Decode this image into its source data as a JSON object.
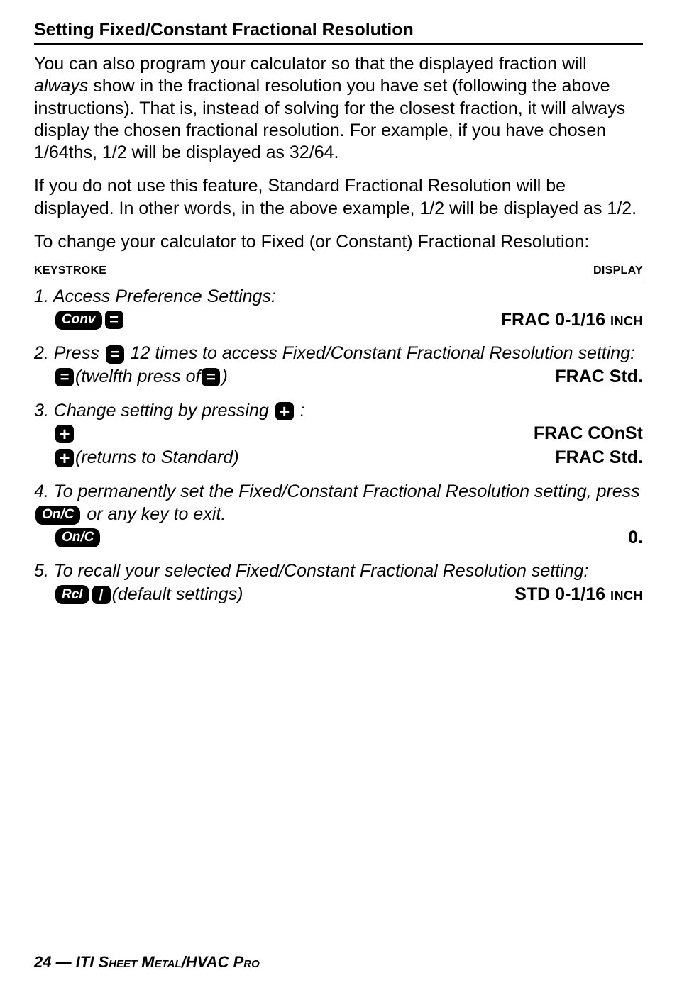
{
  "title": "Setting Fixed/Constant Fractional Resolution",
  "para1_a": "You can also program your calculator so that the displayed fraction will ",
  "para1_b": "always",
  "para1_c": " show in the fractional resolution you have set (following the above instructions). That is, instead of solving for the closest fraction, it will always display the chosen fractional resolution. For example, if you have chosen 1/64ths, 1/2 will be displayed as 32/64.",
  "para2": "If you do not use this feature, Standard Fractional Resolution will be displayed. In other words, in the above example, 1/2 will be displayed as 1/2.",
  "para3": "To change your calculator to Fixed (or Constant) Fractional Resolution:",
  "hdr_left": "KEYSTROKE",
  "hdr_right": "DISPLAY",
  "keys": {
    "conv": "Conv",
    "equal": "=",
    "plus": "+",
    "onc": "On/C",
    "rcl": "Rcl",
    "slash": "/"
  },
  "step1": {
    "label": "1. Access Preference Settings:",
    "result_a": "FRAC  0-1/16 ",
    "result_inch": "INCH"
  },
  "step2": {
    "pre": "2.  Press ",
    "mid": " 12 times to access Fixed/Constant Fractional Resolution setting:",
    "twelfth_a": " (twelfth press of ",
    "twelfth_b": " )",
    "result": "FRAC  Std."
  },
  "step3": {
    "pre": "3. Change setting by pressing ",
    "post": " :",
    "r1": "FRAC  COnSt",
    "ret": " (returns to Standard)",
    "r2": "FRAC  Std."
  },
  "step4": {
    "pre": "4. To permanently set the Fixed/Constant Fractional Resolution setting, press ",
    "post": " or any key to exit.",
    "result": "0."
  },
  "step5": {
    "line": "5. To recall your selected Fixed/Constant Fractional Resolution setting:",
    "def": " (default settings)",
    "result_a": "STD 0-1/16 ",
    "result_inch": "INCH"
  },
  "footer": {
    "page": "24 — ",
    "title": "ITI Sheet Metal/HVAC Pro"
  }
}
